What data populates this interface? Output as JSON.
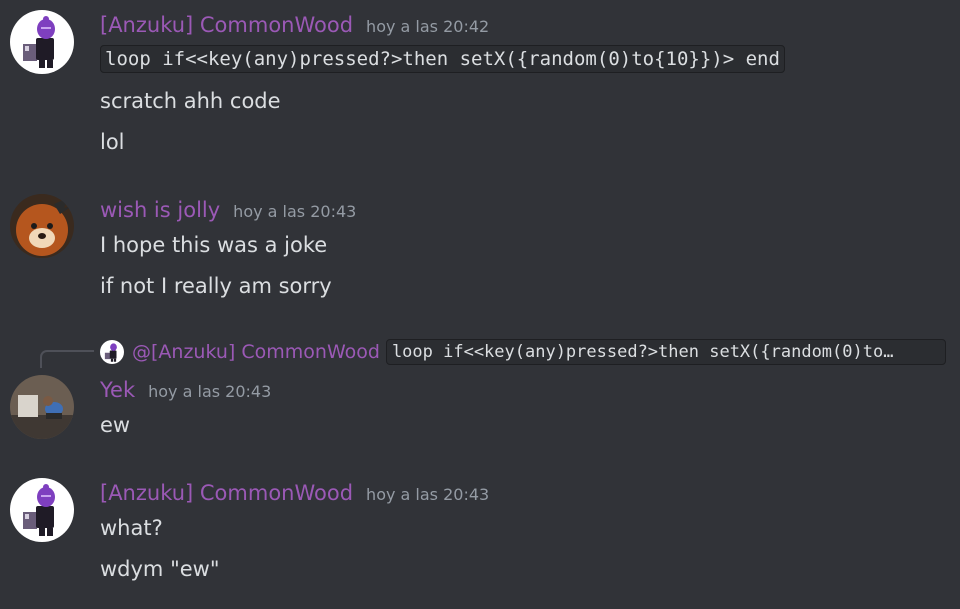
{
  "colors": {
    "background": "#313338",
    "username": "#9b59b6",
    "timestamp": "#949ba4",
    "text": "#dbdee1",
    "code_bg": "#2b2d31"
  },
  "messages": [
    {
      "author": "[Anzuku] CommonWood",
      "time": "hoy a las 20:42",
      "avatar": "purple-robot-avatar",
      "lines": [
        "loop if<<key(any)pressed?>then setX({random(0)to{10}})> end",
        "scratch ahh code",
        "lol"
      ]
    },
    {
      "author": "wish is jolly",
      "time": "hoy a las 20:43",
      "avatar": "fox-bat-avatar",
      "lines": [
        "I hope this was a joke",
        "if not I really am sorry"
      ]
    },
    {
      "reply": {
        "mention": "@[Anzuku] CommonWood",
        "snippet": "loop if<<key(any)pressed?>then setX({random(0)to…"
      },
      "author": "Yek",
      "time": "hoy a las 20:43",
      "avatar": "photo-avatar",
      "lines": [
        "ew"
      ]
    },
    {
      "author": "[Anzuku] CommonWood",
      "time": "hoy a las 20:43",
      "avatar": "purple-robot-avatar",
      "lines": [
        "what?",
        "wdym \"ew\""
      ]
    }
  ]
}
